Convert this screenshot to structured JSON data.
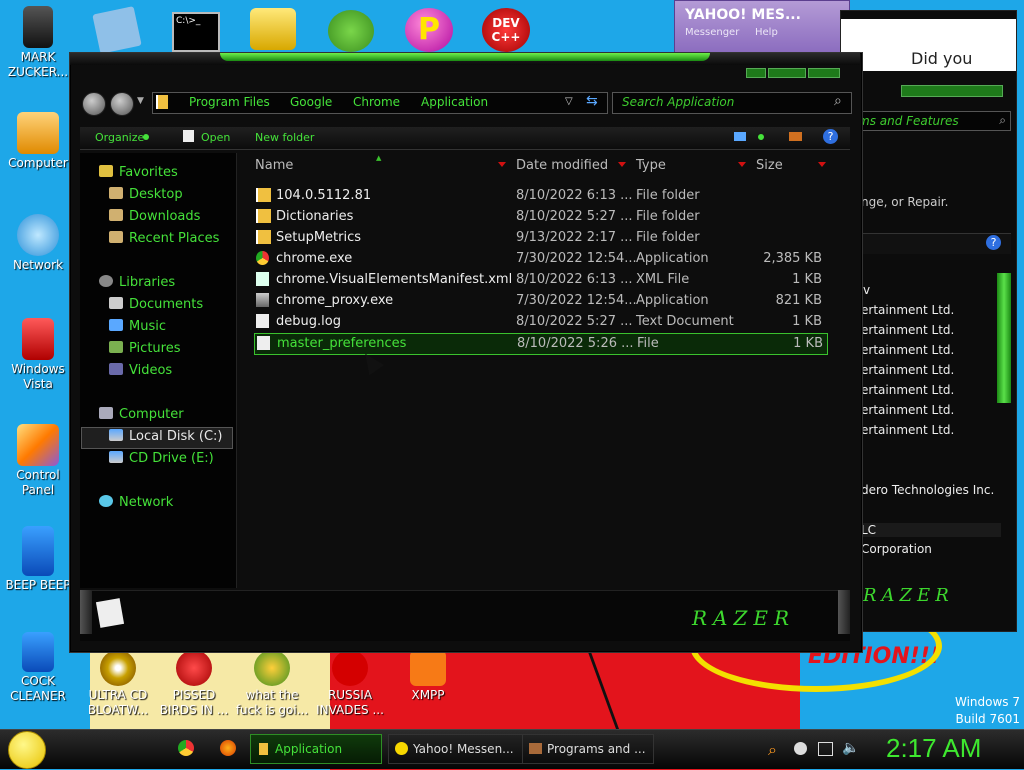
{
  "desktop": {
    "icons_left": [
      {
        "label": "MARK ZUCKER..."
      },
      {
        "label": "Computer"
      },
      {
        "label": "Network"
      },
      {
        "label": "Windows Vista"
      },
      {
        "label": "Control Panel"
      },
      {
        "label": "BEEP BEEP"
      },
      {
        "label": "COCK CLEANER"
      }
    ],
    "icons_bottom": [
      {
        "label": "ULTRA CD BLOATW..."
      },
      {
        "label": "PISSED BIRDS IN ..."
      },
      {
        "label": "what the fuck is goi..."
      },
      {
        "label": "RUSSIA INVADES ..."
      },
      {
        "label": "XMPP"
      }
    ],
    "top_icons": [
      "cmd-icon",
      "notepad-icon",
      "archive-icon",
      "pig-icon",
      "p-icon",
      "devcpp-icon"
    ],
    "top_dev_label": "DEV C++",
    "watermark_line1": "Windows 7",
    "watermark_line2": "Build 7601",
    "edition_text": "EDITION!!!"
  },
  "explorer": {
    "breadcrumb": [
      "Program Files",
      "Google",
      "Chrome",
      "Application"
    ],
    "search_placeholder": "Search Application",
    "commands": {
      "organize": "Organize",
      "open": "Open",
      "new_folder": "New folder"
    },
    "nav": {
      "favorites": "Favorites",
      "desktop": "Desktop",
      "downloads": "Downloads",
      "recent": "Recent Places",
      "libraries": "Libraries",
      "documents": "Documents",
      "music": "Music",
      "pictures": "Pictures",
      "videos": "Videos",
      "computer": "Computer",
      "local_disk": "Local Disk (C:)",
      "cd_drive": "CD Drive (E:)",
      "network": "Network"
    },
    "columns": {
      "name": "Name",
      "date": "Date modified",
      "type": "Type",
      "size": "Size"
    },
    "files": [
      {
        "name": "104.0.5112.81",
        "date": "8/10/2022 6:13 ...",
        "type": "File folder",
        "size": ""
      },
      {
        "name": "Dictionaries",
        "date": "8/10/2022 5:27 ...",
        "type": "File folder",
        "size": ""
      },
      {
        "name": "SetupMetrics",
        "date": "9/13/2022 2:17 ...",
        "type": "File folder",
        "size": ""
      },
      {
        "name": "chrome.exe",
        "date": "7/30/2022 12:54...",
        "type": "Application",
        "size": "2,385 KB"
      },
      {
        "name": "chrome.VisualElementsManifest.xml",
        "date": "8/10/2022 6:13 ...",
        "type": "XML File",
        "size": "1 KB"
      },
      {
        "name": "chrome_proxy.exe",
        "date": "7/30/2022 12:54...",
        "type": "Application",
        "size": "821 KB"
      },
      {
        "name": "debug.log",
        "date": "8/10/2022 5:27 ...",
        "type": "Text Document",
        "size": "1 KB"
      },
      {
        "name": "master_preferences",
        "date": "8/10/2022 5:26 ...",
        "type": "File",
        "size": "1 KB"
      }
    ],
    "brand": "RAZER"
  },
  "programs_window": {
    "search_fragment": "ms and Features",
    "desc_fragment": "nge, or Repair.",
    "publishers": [
      "ertainment Ltd.",
      "ertainment Ltd.",
      "ertainment Ltd.",
      "ertainment Ltd.",
      "ertainment Ltd.",
      "ertainment Ltd.",
      "ertainment Ltd."
    ],
    "v_fragment": "v",
    "lower_publisher": "dero Technologies Inc.",
    "llc_fragment": "LC",
    "corp_fragment": "Corporation",
    "title_fragment": "Did you"
  },
  "yahoo": {
    "title": "YAHOO! MES...",
    "subtitle": "Messenger",
    "help": "Help"
  },
  "taskbar": {
    "apps": [
      {
        "label": "Application"
      },
      {
        "label": "Yahoo! Messen..."
      },
      {
        "label": "Programs and ..."
      }
    ],
    "clock": "2:17 AM"
  }
}
